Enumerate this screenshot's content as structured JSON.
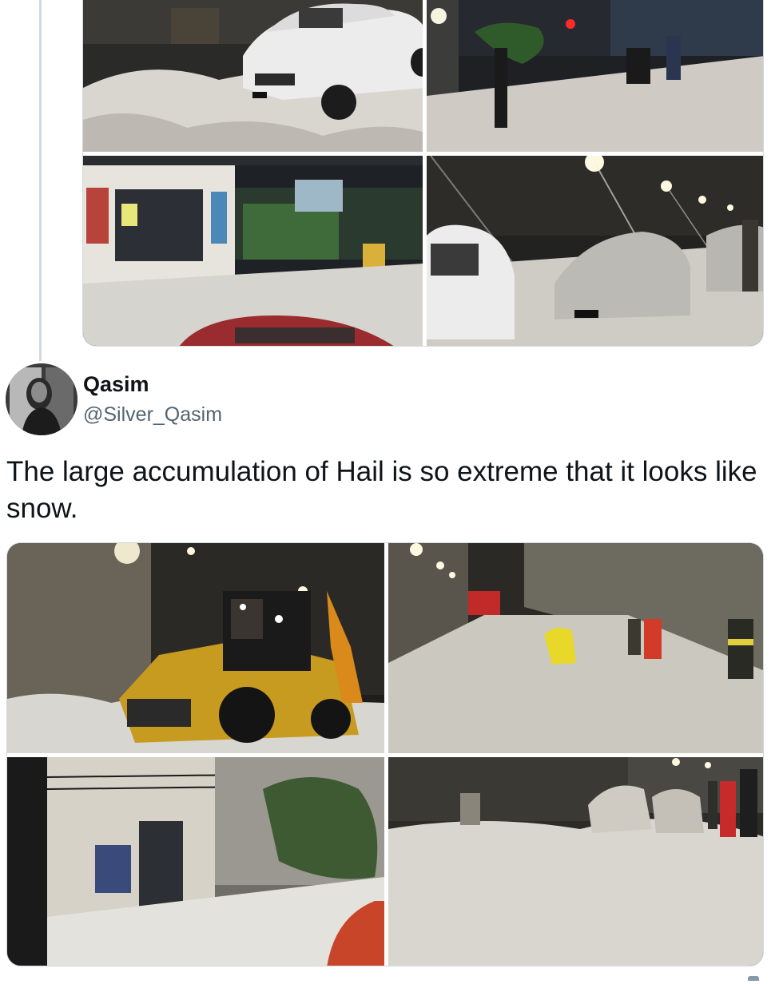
{
  "thread": {
    "previous_tweet_photos": [
      {
        "alt": "",
        "scene": "white car buried in hail at night"
      },
      {
        "alt": "",
        "scene": "people in street covered with hail under bridge"
      },
      {
        "alt": "",
        "scene": "storefront with hail-covered sidewalk and red car"
      },
      {
        "alt": "",
        "scene": "cars covered in hail under street lights"
      }
    ]
  },
  "tweet": {
    "display_name": "Qasim",
    "handle": "@Silver_Qasim",
    "text": "The large accumulation of Hail is so extreme that it looks like snow.",
    "avatar_icon": "user-avatar",
    "photos": [
      {
        "alt": "",
        "scene": "yellow backhoe clearing hail at night"
      },
      {
        "alt": "",
        "scene": "rescuers in raincoats in hail-filled street"
      },
      {
        "alt": "",
        "scene": "building facade with street flooded by hail"
      },
      {
        "alt": "",
        "scene": "cars buried in hail with firefighters"
      }
    ]
  },
  "colors": {
    "thread_line": "#cfd9de",
    "handle": "#536471",
    "text": "#0f1419"
  }
}
